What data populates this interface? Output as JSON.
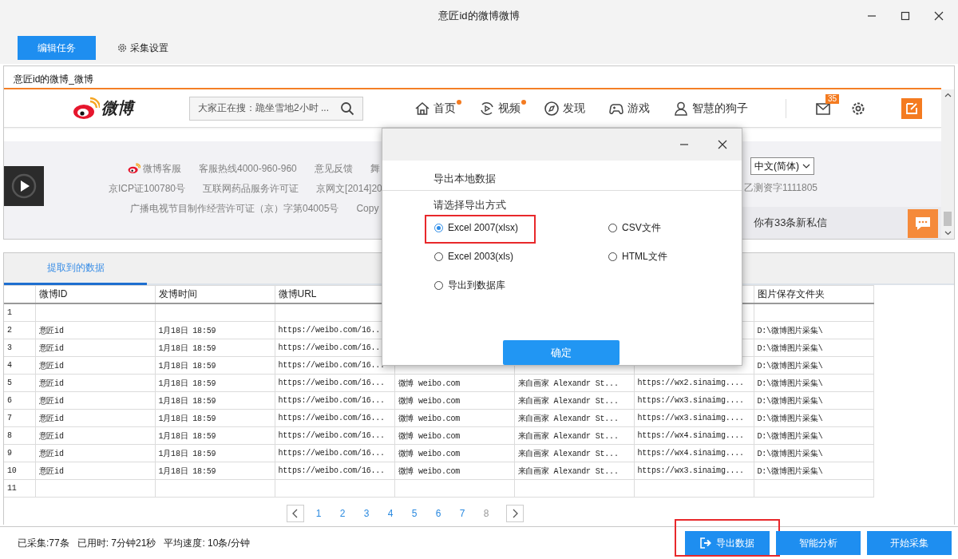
{
  "window": {
    "title": "意匠id的微博微博"
  },
  "toolbar": {
    "buttons": [
      {
        "label": "编辑任务",
        "kind": "primary"
      },
      {
        "label": "采集设置",
        "kind": "settings"
      }
    ]
  },
  "browser": {
    "tab": "意匠id的微博_微博",
    "site": {
      "logo_text": "微博",
      "search_placeholder": "大家正在搜：跪坐雪地2小时 ...",
      "nav": [
        {
          "label": "首页",
          "kind": "home",
          "dot": true
        },
        {
          "label": "视频",
          "kind": "video",
          "dot": true
        },
        {
          "label": "发现",
          "kind": "discover",
          "dot": false
        },
        {
          "label": "游戏",
          "kind": "game",
          "dot": false
        },
        {
          "label": "智慧的狗子",
          "kind": "user",
          "dot": false
        }
      ],
      "mail_badge": "35"
    },
    "footer": {
      "service": "微博客服",
      "lines": [
        [
          "客服热线4000-960-960",
          "意见反馈",
          "舞"
        ],
        [
          "京ICP证100780号",
          "互联网药品服务许可证",
          "京网文[2014]20"
        ],
        [
          "广播电视节目制作经营许可证（京）字第04005号",
          "Copy"
        ]
      ],
      "language": "中文(简体)",
      "license": "乙测资字1111805"
    },
    "message_bar": "你有33条新私信"
  },
  "data_panel": {
    "tab": {
      "label": "提取到的数据",
      "selected": true
    },
    "table": {
      "columns": [
        "微博ID",
        "发博时间",
        "微博URL",
        null,
        null,
        null,
        "图片保存文件夹"
      ],
      "rows": [
        {
          "index": "1",
          "cells": [
            null,
            null,
            null,
            null,
            null,
            null,
            null
          ]
        },
        {
          "index": "2",
          "cells": [
            "意匠id",
            "1月18日 18:59",
            "https://weibo.com/16..",
            null,
            null,
            null,
            "D:\\微博图片采集\\"
          ]
        },
        {
          "index": "3",
          "cells": [
            "意匠id",
            "1月18日 18:59",
            "https://weibo.com/16..",
            null,
            null,
            null,
            "D:\\微博图片采集\\"
          ]
        },
        {
          "index": "4",
          "cells": [
            "意匠id",
            "1月18日 18:59",
            "https://weibo.com/16...",
            null,
            null,
            null,
            "D:\\微博图片采集\\"
          ]
        },
        {
          "index": "5",
          "cells": [
            "意匠id",
            "1月18日 18:59",
            "https://weibo.com/16...",
            "微博 weibo.com",
            "来自画家 Alexandr St...",
            "https://wx2.sinaimg....",
            "D:\\微博图片采集\\"
          ]
        },
        {
          "index": "6",
          "cells": [
            "意匠id",
            "1月18日 18:59",
            "https://weibo.com/16...",
            "微博 weibo.com",
            "来自画家 Alexandr St...",
            "https://wx3.sinaimg....",
            "D:\\微博图片采集\\"
          ]
        },
        {
          "index": "7",
          "cells": [
            "意匠id",
            "1月18日 18:59",
            "https://weibo.com/16...",
            "微博 weibo.com",
            "来自画家 Alexandr St...",
            "https://wx3.sinaimg....",
            "D:\\微博图片采集\\"
          ]
        },
        {
          "index": "8",
          "cells": [
            "意匠id",
            "1月18日 18:59",
            "https://weibo.com/16...",
            "微博 weibo.com",
            "来自画家 Alexandr St...",
            "https://wx4.sinaimg....",
            "D:\\微博图片采集\\"
          ]
        },
        {
          "index": "9",
          "cells": [
            "意匠id",
            "1月18日 18:59",
            "https://weibo.com/16...",
            "微博 weibo.com",
            "来自画家 Alexandr St...",
            "https://wx4.sinaimg....",
            "D:\\微博图片采集\\"
          ]
        },
        {
          "index": "10",
          "cells": [
            "意匠id",
            "1月18日 18:59",
            "https://weibo.com/16...",
            "微博 weibo.com",
            "来自画家 Alexandr St...",
            "https://wx3.sinaimg....",
            "D:\\微博图片采集\\"
          ]
        },
        {
          "index": "11",
          "cells": [
            null,
            null,
            null,
            null,
            null,
            null,
            null
          ]
        }
      ]
    },
    "pagination": {
      "pages": [
        {
          "label": "1",
          "selected": false
        },
        {
          "label": "2",
          "selected": false
        },
        {
          "label": "3",
          "selected": false
        },
        {
          "label": "4",
          "selected": false
        },
        {
          "label": "5",
          "selected": false
        },
        {
          "label": "6",
          "selected": false
        },
        {
          "label": "7",
          "selected": false
        },
        {
          "label": "8",
          "selected": true
        }
      ]
    }
  },
  "status_bar": {
    "stats": [
      "已采集:77条",
      "已用时: 7分钟21秒",
      "平均速度: 10条/分钟"
    ],
    "buttons": [
      {
        "label": "导出数据",
        "kind": "export",
        "highlighted": true
      },
      {
        "label": "智能分析",
        "kind": "plain",
        "highlighted": false
      },
      {
        "label": "开始采集",
        "kind": "plain",
        "highlighted": false
      }
    ]
  },
  "export_dialog": {
    "heading": "导出本地数据",
    "prompt": "请选择导出方式",
    "options": [
      {
        "label": "Excel 2007(xlsx)",
        "selected": true,
        "highlighted": true
      },
      {
        "label": "CSV文件",
        "selected": false,
        "highlighted": false
      },
      {
        "label": "Excel 2003(xls)",
        "selected": false,
        "highlighted": false
      },
      {
        "label": "HTML文件",
        "selected": false,
        "highlighted": false
      },
      {
        "label": "导出到数据库",
        "selected": false,
        "highlighted": false
      }
    ],
    "confirm": "确定"
  }
}
